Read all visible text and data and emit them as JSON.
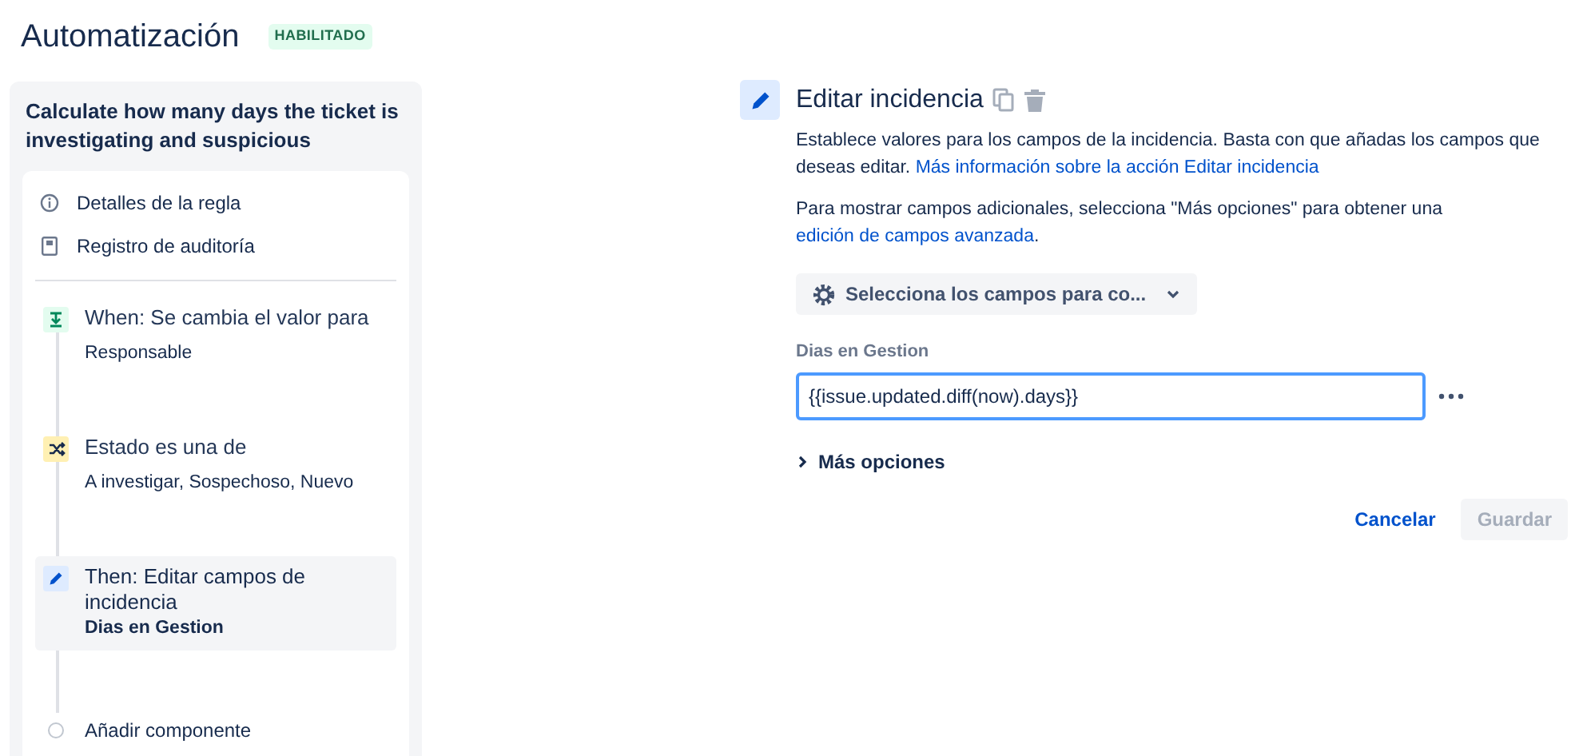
{
  "header": {
    "title": "Automatización",
    "badge": "HABILITADO"
  },
  "sidebar": {
    "rule_name": "Calculate how many days the ticket is investigating and suspicious",
    "menu": [
      {
        "kind": "info",
        "label": "Detalles de la regla"
      },
      {
        "kind": "audit",
        "label": "Registro de auditoría"
      }
    ],
    "steps": [
      {
        "kind": "trigger",
        "title": "When: Se cambia el valor para",
        "detail": "Responsable",
        "selected": false
      },
      {
        "kind": "condition",
        "title": "Estado es una de",
        "detail": "A investigar, Sospechoso, Nuevo",
        "selected": false
      },
      {
        "kind": "action",
        "title": "Then: Editar campos de incidencia",
        "detail": "Dias en Gestion",
        "selected": true
      },
      {
        "kind": "add",
        "title": "Añadir componente",
        "selected": false
      }
    ]
  },
  "editor": {
    "title": "Editar incidencia",
    "paragraphs": [
      {
        "before": "Establece valores para los campos de la incidencia. Basta con que añadas los campos que deseas editar. ",
        "link": "Más información sobre la acción Editar incidencia"
      },
      {
        "before": "Para mostrar campos adicionales, selecciona \"Más opciones\" para obtener una ",
        "link": "edición de campos avanzada",
        "after": "."
      }
    ],
    "field_picker": "Selecciona los campos para co...",
    "field": {
      "label": "Dias en Gestion",
      "value": "{{issue.updated.diff(now).days}}"
    },
    "more_options": "Más opciones",
    "buttons": [
      {
        "label": "Cancelar",
        "kind": "link",
        "disabled": false
      },
      {
        "label": "Guardar",
        "kind": "primary",
        "disabled": true
      }
    ]
  }
}
